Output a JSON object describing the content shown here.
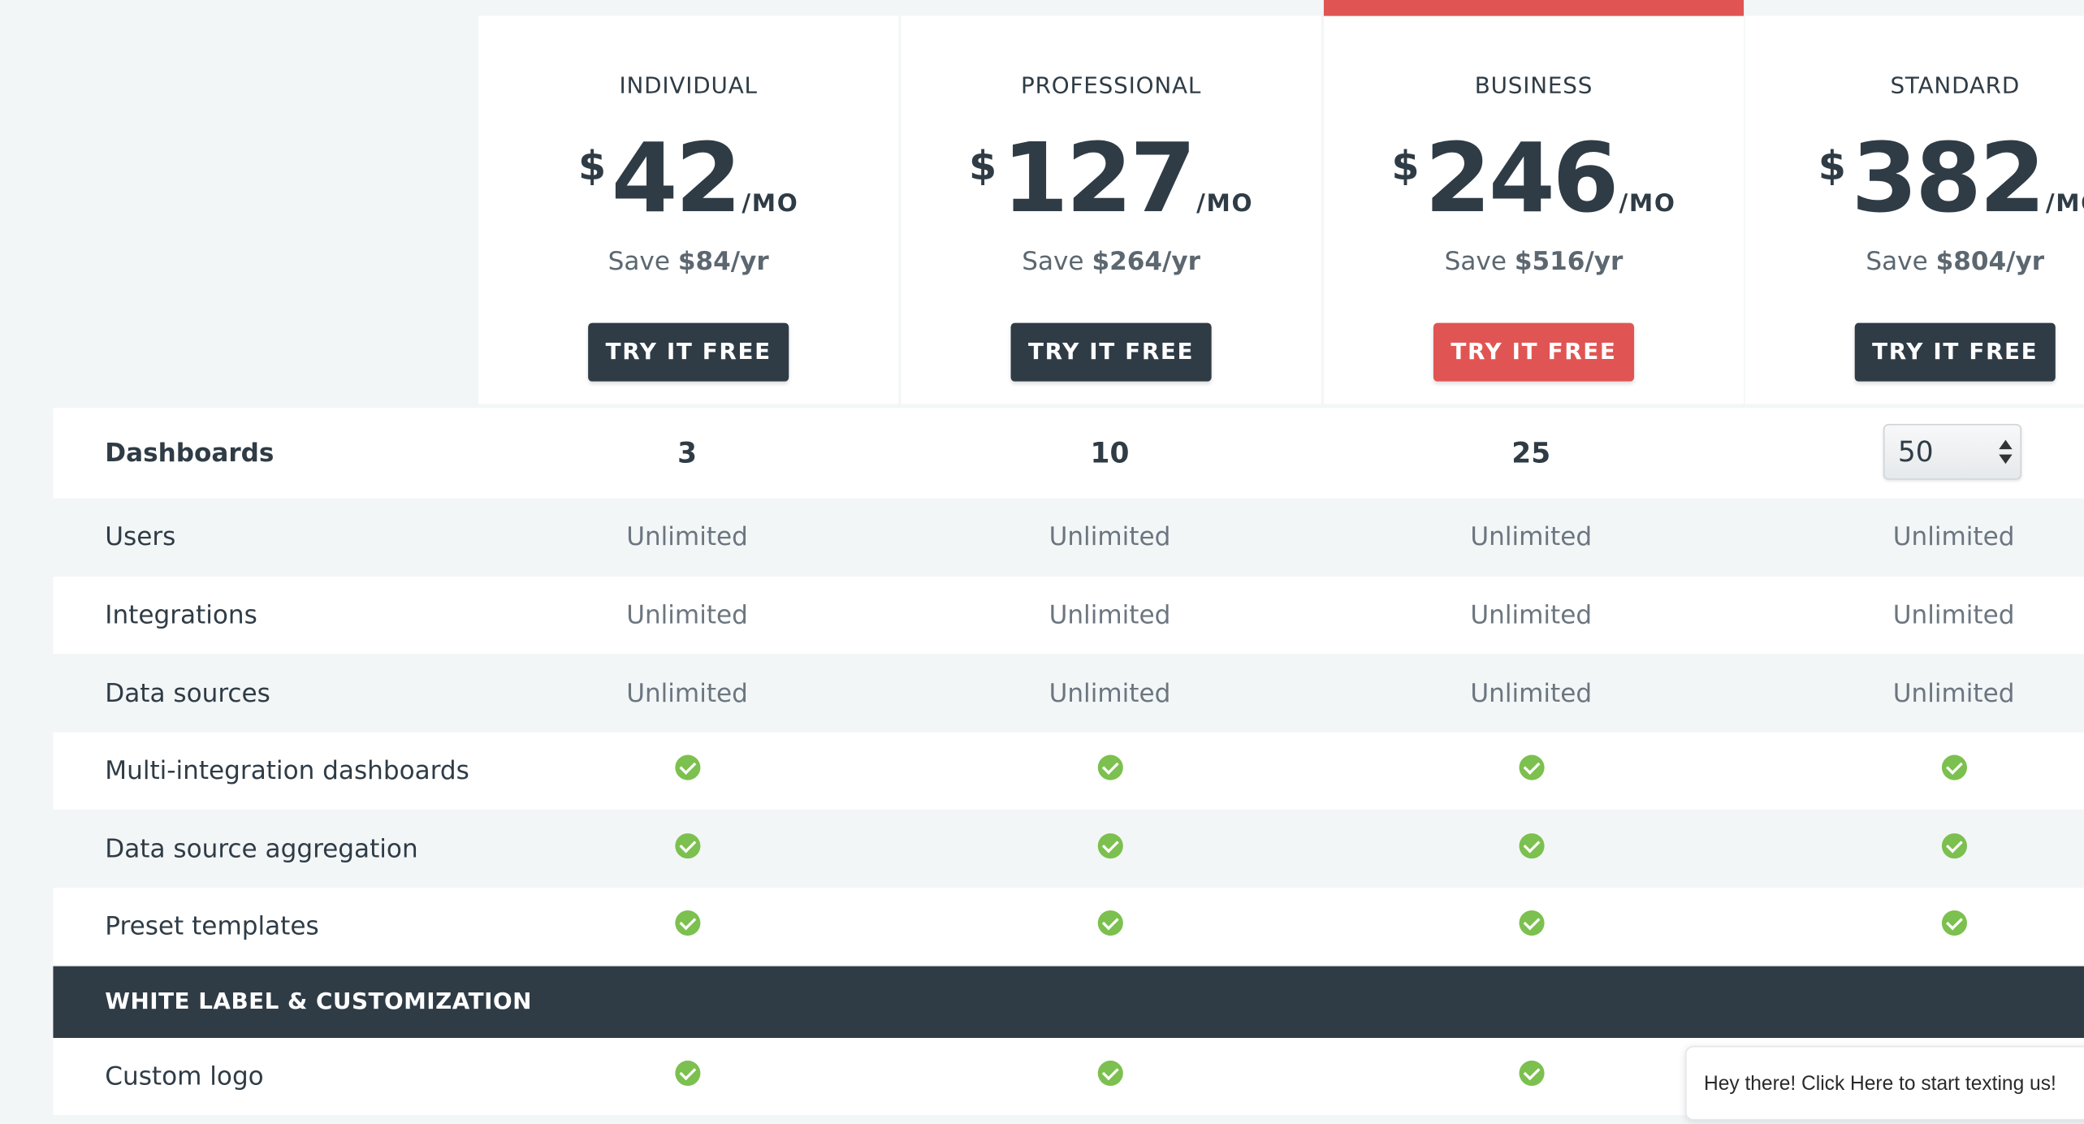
{
  "plans": [
    {
      "name": "INDIVIDUAL",
      "currency": "$",
      "amount": "42",
      "period": "/MO",
      "save_prefix": "Save",
      "save_amount": "$84/yr",
      "cta": "TRY IT FREE"
    },
    {
      "name": "PROFESSIONAL",
      "currency": "$",
      "amount": "127",
      "period": "/MO",
      "save_prefix": "Save",
      "save_amount": "$264/yr",
      "cta": "TRY IT FREE"
    },
    {
      "name": "BUSINESS",
      "currency": "$",
      "amount": "246",
      "period": "/MO",
      "save_prefix": "Save",
      "save_amount": "$516/yr",
      "cta": "TRY IT FREE"
    },
    {
      "name": "STANDARD",
      "currency": "$",
      "amount": "382",
      "period": "/MO",
      "save_prefix": "Save",
      "save_amount": "$804/yr",
      "cta": "TRY IT FREE"
    }
  ],
  "featured_color": "#e05553",
  "features": {
    "dashboards": {
      "label": "Dashboards",
      "values": [
        "3",
        "10",
        "25"
      ],
      "select_value": "50"
    },
    "users": {
      "label": "Users",
      "values": [
        "Unlimited",
        "Unlimited",
        "Unlimited",
        "Unlimited"
      ]
    },
    "integrations": {
      "label": "Integrations",
      "values": [
        "Unlimited",
        "Unlimited",
        "Unlimited",
        "Unlimited"
      ]
    },
    "data_sources": {
      "label": "Data sources",
      "values": [
        "Unlimited",
        "Unlimited",
        "Unlimited",
        "Unlimited"
      ]
    },
    "multi_integration": {
      "label": "Multi-integration dashboards",
      "included": [
        true,
        true,
        true,
        true
      ]
    },
    "aggregation": {
      "label": "Data source aggregation",
      "included": [
        true,
        true,
        true,
        true
      ]
    },
    "templates": {
      "label": "Preset templates",
      "included": [
        true,
        true,
        true,
        true
      ]
    }
  },
  "section": {
    "title": "WHITE LABEL & CUSTOMIZATION"
  },
  "custom_logo": {
    "label": "Custom logo",
    "included": [
      true,
      true,
      true
    ]
  },
  "chat": {
    "text": "Hey there! Click Here to start texting us!"
  },
  "icons": {
    "check": "check-circle-icon",
    "select_arrows": "up-down-arrows-icon"
  }
}
